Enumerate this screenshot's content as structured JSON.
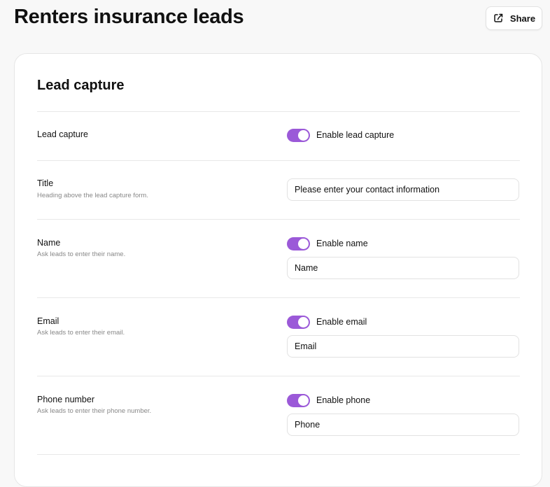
{
  "header": {
    "title": "Renters insurance leads",
    "share_label": "Share"
  },
  "card": {
    "title": "Lead capture"
  },
  "lead_capture": {
    "label": "Lead capture",
    "toggle_label": "Enable lead capture",
    "enabled": true
  },
  "title_field": {
    "label": "Title",
    "description": "Heading above the lead capture form.",
    "value": "Please enter your contact information"
  },
  "name_field": {
    "label": "Name",
    "description": "Ask leads to enter their name.",
    "toggle_label": "Enable name",
    "enabled": true,
    "value": "Name"
  },
  "email_field": {
    "label": "Email",
    "description": "Ask leads to enter their email.",
    "toggle_label": "Enable email",
    "enabled": true,
    "value": "Email"
  },
  "phone_field": {
    "label": "Phone number",
    "description": "Ask leads to enter their phone number.",
    "toggle_label": "Enable phone",
    "enabled": true,
    "value": "Phone"
  },
  "colors": {
    "toggle_on": "#9b59d8",
    "page_background": "#f8f8f8"
  }
}
